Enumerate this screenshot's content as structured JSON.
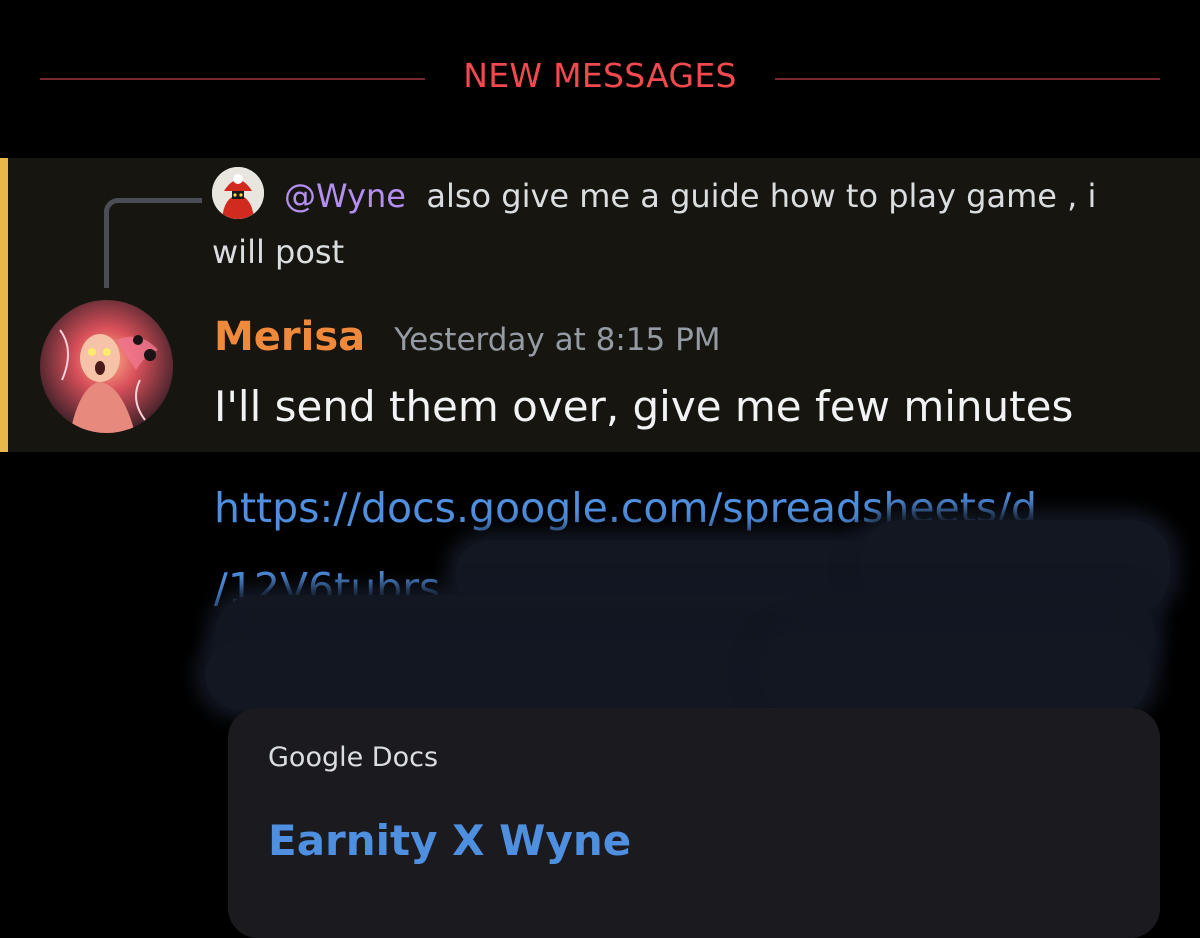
{
  "divider": {
    "label": "NEW MESSAGES"
  },
  "reply": {
    "mention": "@Wyne",
    "text": "also give me a guide how to play game , i will post"
  },
  "message": {
    "author": "Merisa",
    "timestamp": "Yesterday at 8:15 PM",
    "content": "I'll send them over, give me few minutes"
  },
  "link": {
    "line1": "https://docs.google.com/spreadsheets/d",
    "line2": "/12V6tubrs"
  },
  "embed": {
    "provider": "Google Docs",
    "title": "Earnity X Wyne"
  },
  "colors": {
    "new_messages": "#f04a4f",
    "mention": "#b48ff2",
    "author": "#f08a3a",
    "link": "#4f8fe0",
    "highlight_bar": "#e8b84a"
  }
}
